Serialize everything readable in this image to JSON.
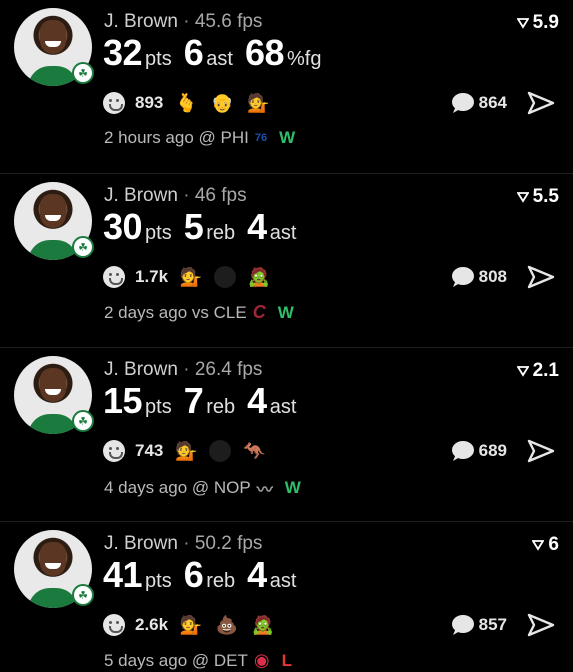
{
  "colors": {
    "win": "#2fbf6a",
    "loss": "#e53535",
    "background": "#000000"
  },
  "posts": [
    {
      "player": "J. Brown",
      "separator": "·",
      "fps": "45.6 fps",
      "score": "5.9",
      "stats": [
        {
          "num": "32",
          "unit": "pts"
        },
        {
          "num": "6",
          "unit": "ast"
        },
        {
          "num": "68",
          "unit": "%fg"
        }
      ],
      "reaction_count": "893",
      "reaction_emojis": [
        "🫰",
        "👴",
        "💁"
      ],
      "comments": "864",
      "time": "2 hours ago @ PHI",
      "team_logo": "76",
      "team_color": "#1d4fb0",
      "result": "W"
    },
    {
      "player": "J. Brown",
      "separator": "·",
      "fps": "46 fps",
      "score": "5.5",
      "stats": [
        {
          "num": "30",
          "unit": "pts"
        },
        {
          "num": "5",
          "unit": "reb"
        },
        {
          "num": "4",
          "unit": "ast"
        }
      ],
      "reaction_count": "1.7k",
      "reaction_emojis": [
        "💁",
        "",
        "🧟"
      ],
      "comments": "808",
      "time": "2 days ago vs CLE",
      "team_logo": "C",
      "team_color": "#a3263b",
      "result": "W"
    },
    {
      "player": "J. Brown",
      "separator": "·",
      "fps": "26.4 fps",
      "score": "2.1",
      "stats": [
        {
          "num": "15",
          "unit": "pts"
        },
        {
          "num": "7",
          "unit": "reb"
        },
        {
          "num": "4",
          "unit": "ast"
        }
      ],
      "reaction_count": "743",
      "reaction_emojis": [
        "💁",
        "",
        "🦘"
      ],
      "comments": "689",
      "time": "4 days ago @ NOP",
      "team_logo": "〰",
      "team_color": "#9a9a9a",
      "result": "W"
    },
    {
      "player": "J. Brown",
      "separator": "·",
      "fps": "50.2 fps",
      "score": "6",
      "stats": [
        {
          "num": "41",
          "unit": "pts"
        },
        {
          "num": "6",
          "unit": "reb"
        },
        {
          "num": "4",
          "unit": "ast"
        }
      ],
      "reaction_count": "2.6k",
      "reaction_emojis": [
        "💁",
        "💩",
        "🧟"
      ],
      "comments": "857",
      "time": "5 days ago @ DET",
      "team_logo": "◉",
      "team_color": "#d8304a",
      "result": "L"
    }
  ]
}
